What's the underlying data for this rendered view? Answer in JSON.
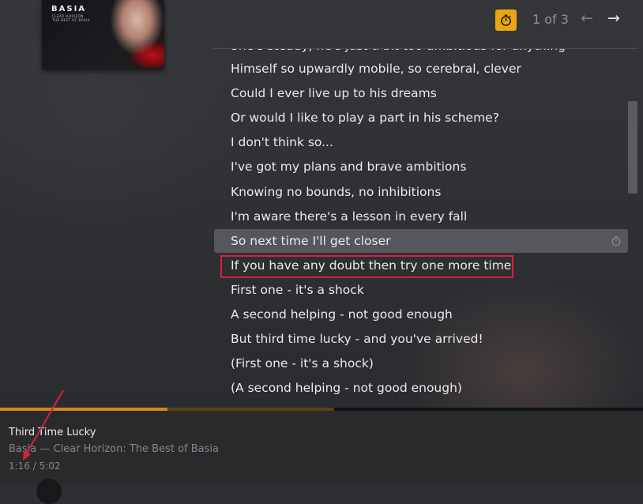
{
  "album": {
    "title": "BASIA",
    "subtitle": "CLEAR HORIZON\nTHE BEST OF BASIA"
  },
  "header": {
    "page_indicator": "1 of 3",
    "prev_icon": "arrow-left-icon",
    "next_icon": "arrow-right-icon",
    "timer_icon": "stopwatch-icon",
    "accent_color": "#e9a60e"
  },
  "lyrics": {
    "lines": [
      "Himself so upwardly mobile, so cerebral, clever",
      "Could I ever live up to his dreams",
      "Or would I like to play a part in his scheme?",
      "I don't think so...",
      "I've got my plans and brave ambitions",
      "Knowing no bounds, no inhibitions",
      "I'm aware there's a lesson in every fall",
      "So next time I'll get closer",
      "If you have any doubt then try one more time",
      "First one - it's a shock",
      "A second helping - not good enough",
      "But third time lucky - and you've arrived!",
      "(First one - it's a shock)",
      "(A second helping - not good enough)"
    ],
    "active_index": 7,
    "highlight_color": "#d8203e"
  },
  "player": {
    "track_title": "Third Time Lucky",
    "track_artist": "Basia — Clear Horizon: The Best of Basia",
    "time": "1:16 / 5:02",
    "progress": 0.26,
    "buffered": 0.52,
    "progress_color": "#d08a18"
  }
}
